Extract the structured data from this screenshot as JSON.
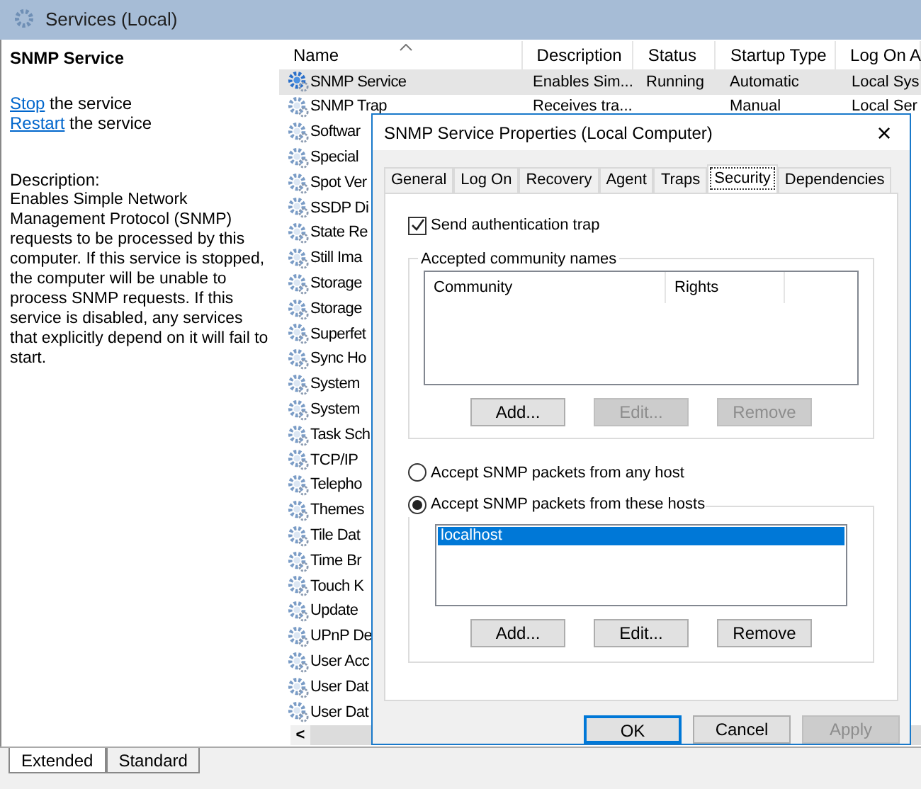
{
  "window": {
    "title": "Services (Local)"
  },
  "details": {
    "service_name": "SNMP Service",
    "actions": [
      {
        "link": "Stop",
        "rest": " the service"
      },
      {
        "link": "Restart",
        "rest": " the service"
      }
    ],
    "description_label": "Description:",
    "description": "Enables Simple Network Management Protocol (SNMP) requests to be processed by this computer. If this service is stopped, the computer will be unable to process SNMP requests. If this service is disabled, any services that explicitly depend on it will fail to start."
  },
  "table": {
    "columns": [
      "Name",
      "Description",
      "Status",
      "Startup Type",
      "Log On A"
    ],
    "rows": [
      {
        "name": "SNMP Service",
        "description": "Enables Sim...",
        "status": "Running",
        "startup": "Automatic",
        "logon": "Local Sys",
        "selected": true
      },
      {
        "name": "SNMP Trap",
        "description": "Receives tra...",
        "startup": "Manual",
        "logon": "Local Ser",
        "selected": false
      },
      {
        "name": "Softwar",
        "selected": false
      },
      {
        "name": "Special",
        "selected": false
      },
      {
        "name": "Spot Ver",
        "selected": false
      },
      {
        "name": "SSDP Di",
        "selected": false
      },
      {
        "name": "State Re",
        "selected": false
      },
      {
        "name": "Still Ima",
        "selected": false
      },
      {
        "name": "Storage",
        "selected": false
      },
      {
        "name": "Storage",
        "selected": false
      },
      {
        "name": "Superfet",
        "selected": false
      },
      {
        "name": "Sync Ho",
        "selected": false
      },
      {
        "name": "System",
        "selected": false
      },
      {
        "name": "System",
        "selected": false
      },
      {
        "name": "Task Sch",
        "selected": false
      },
      {
        "name": "TCP/IP",
        "selected": false
      },
      {
        "name": "Telepho",
        "selected": false
      },
      {
        "name": "Themes",
        "selected": false
      },
      {
        "name": "Tile Dat",
        "selected": false
      },
      {
        "name": "Time Br",
        "selected": false
      },
      {
        "name": "Touch K",
        "selected": false
      },
      {
        "name": "Update",
        "selected": false
      },
      {
        "name": "UPnP De",
        "selected": false
      },
      {
        "name": "User Acc",
        "selected": false
      },
      {
        "name": "User Dat",
        "selected": false
      },
      {
        "name": "User Dat",
        "selected": false
      }
    ],
    "scroll_left": "<"
  },
  "view_tabs": [
    {
      "label": "Extended",
      "selected": true
    },
    {
      "label": "Standard",
      "selected": false
    }
  ],
  "dialog": {
    "title": "SNMP Service Properties (Local Computer)",
    "close": "×",
    "tabs": [
      {
        "label": "General",
        "selected": false
      },
      {
        "label": "Log On",
        "selected": false
      },
      {
        "label": "Recovery",
        "selected": false
      },
      {
        "label": "Agent",
        "selected": false
      },
      {
        "label": "Traps",
        "selected": false
      },
      {
        "label": "Security",
        "selected": true
      },
      {
        "label": "Dependencies",
        "selected": false
      }
    ],
    "send_trap": {
      "label": "Send authentication trap",
      "checked": true
    },
    "community": {
      "legend": "Accepted community names",
      "columns": [
        "Community",
        "Rights"
      ],
      "buttons": [
        {
          "label": "Add...",
          "disabled": false
        },
        {
          "label": "Edit...",
          "disabled": true
        },
        {
          "label": "Remove",
          "disabled": true
        }
      ]
    },
    "host_options": [
      {
        "label": "Accept SNMP packets from any host",
        "selected": false
      },
      {
        "label": "Accept SNMP packets from these hosts",
        "selected": true
      }
    ],
    "hosts": [
      {
        "name": "localhost",
        "selected": true
      }
    ],
    "host_buttons": [
      {
        "label": "Add...",
        "disabled": false
      },
      {
        "label": "Edit...",
        "disabled": false
      },
      {
        "label": "Remove",
        "disabled": false
      }
    ],
    "footer": [
      {
        "label": "OK",
        "disabled": false,
        "default": true
      },
      {
        "label": "Cancel",
        "disabled": false,
        "default": false
      },
      {
        "label": "Apply",
        "disabled": true,
        "default": false
      }
    ]
  }
}
